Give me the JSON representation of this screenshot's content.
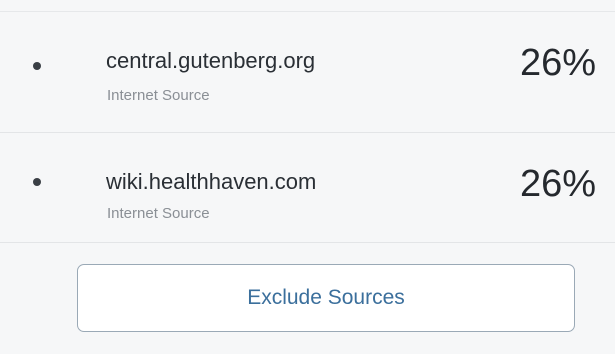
{
  "sources": [
    {
      "name": "central.gutenberg.org",
      "type": "Internet Source",
      "percent": "26%"
    },
    {
      "name": "wiki.healthhaven.com",
      "type": "Internet Source",
      "percent": "26%"
    }
  ],
  "actions": {
    "exclude_label": "Exclude Sources"
  }
}
